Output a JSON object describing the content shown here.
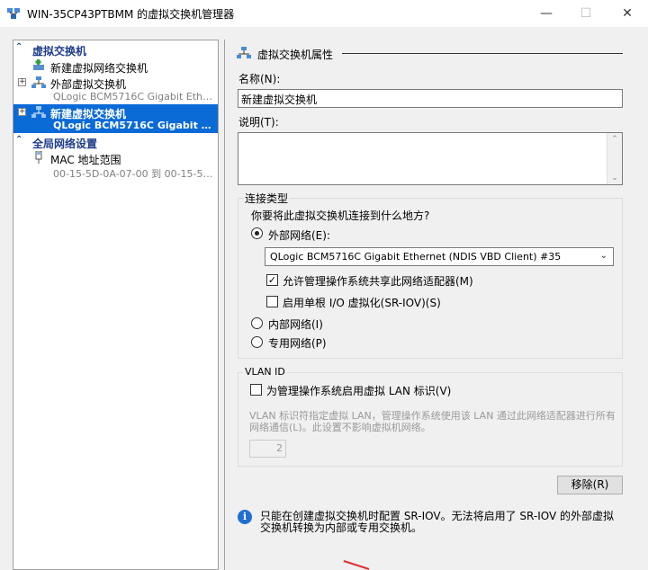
{
  "window": {
    "title": "WIN-35CP43PTBMM 的虚拟交换机管理器",
    "minimize": "—",
    "maximize": "☐",
    "close": "✕"
  },
  "sidebar": {
    "section_virtual_switches": "虚拟交换机",
    "new_network_switch": "新建虚拟网络交换机",
    "external_switch": {
      "label": "外部虚拟交换机",
      "sub": "QLogic BCM5716C Gigabit Etherne..."
    },
    "new_switch": {
      "label": "新建虚拟交换机",
      "sub": "QLogic BCM5716C Gigabit Ethe..."
    },
    "section_global": "全局网络设置",
    "mac_range": {
      "label": "MAC 地址范围",
      "sub": "00-15-5D-0A-07-00 到 00-15-5D-0..."
    },
    "expander_plus": "+",
    "collapse_glyph": "⌃"
  },
  "properties": {
    "group_title": "虚拟交换机属性",
    "name_label": "名称(N):",
    "name_value": "新建虚拟交换机",
    "notes_label": "说明(T):",
    "notes_value": ""
  },
  "connection": {
    "frame_title": "连接类型",
    "question": "你要将此虚拟交换机连接到什么地方?",
    "external_label": "外部网络(E):",
    "adapter_selected": "QLogic BCM5716C Gigabit Ethernet (NDIS VBD Client) #35",
    "allow_mgmt_label": "允许管理操作系统共享此网络适配器(M)",
    "allow_mgmt_checked": true,
    "sriov_label": "启用单根 I/O 虚拟化(SR-IOV)(S)",
    "sriov_checked": false,
    "internal_label": "内部网络(I)",
    "private_label": "专用网络(P)",
    "selected_type": "external"
  },
  "vlan": {
    "frame_title": "VLAN ID",
    "enable_label": "为管理操作系统启用虚拟 LAN 标识(V)",
    "enable_checked": false,
    "description": "VLAN 标识符指定虚拟 LAN，管理操作系统使用该 LAN 通过此网络适配器进行所有网络通信(L)。此设置不影响虚拟机网络。",
    "vlan_value": "2"
  },
  "buttons": {
    "remove": "移除(R)"
  },
  "info": {
    "icon": "i",
    "text": "只能在创建虚拟交换机时配置 SR-IOV。无法将启用了 SR-IOV 的外部虚拟交换机转换为内部或专用交换机。"
  },
  "colors": {
    "selection": "#0a6ad6",
    "section_heading": "#1e3c8c",
    "info_icon": "#1e6fd0"
  }
}
